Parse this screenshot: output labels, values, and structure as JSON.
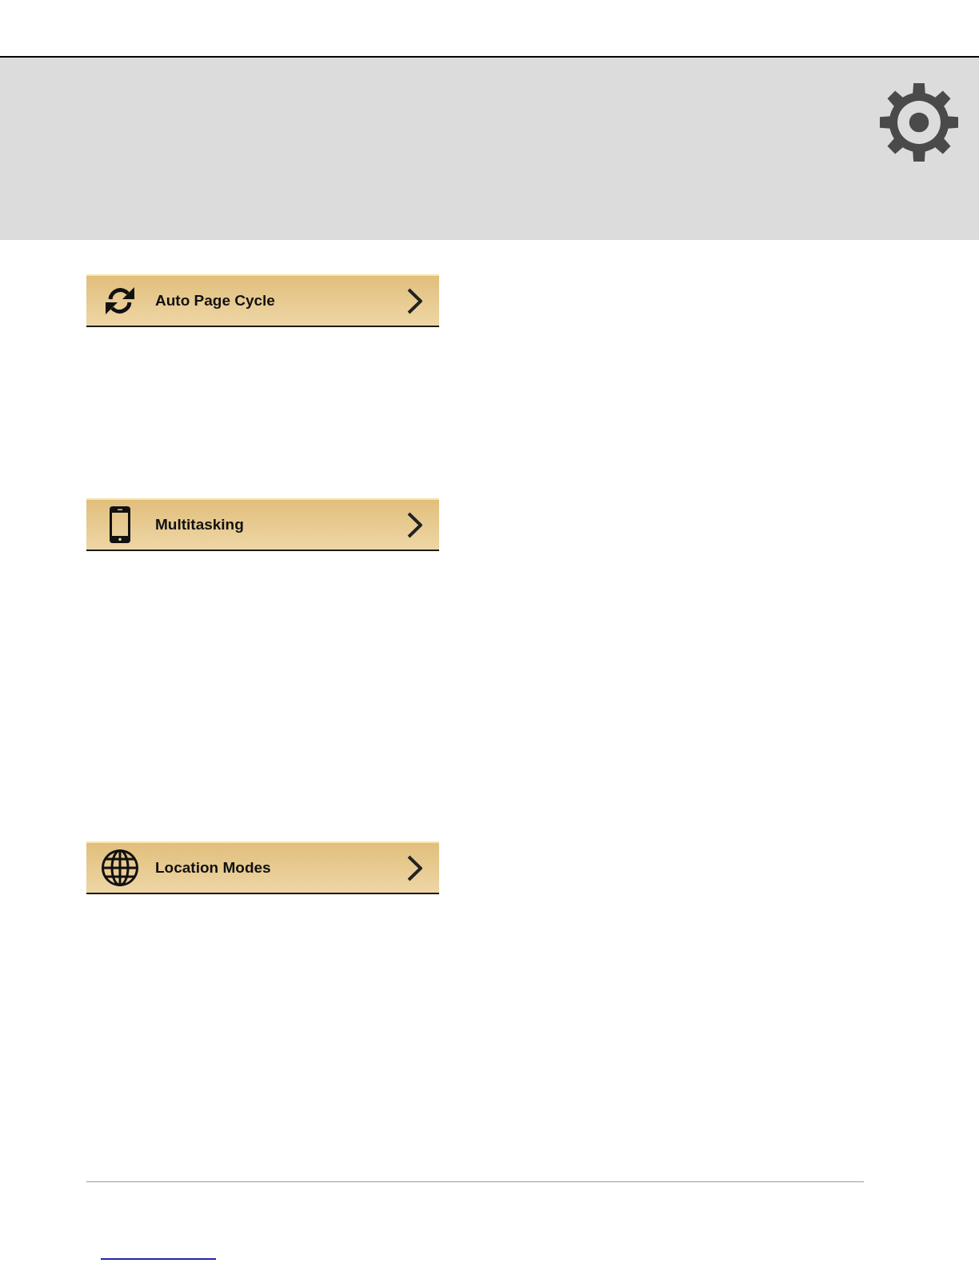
{
  "settings_items": [
    {
      "label": "Auto Page Cycle"
    },
    {
      "label": "Multitasking"
    },
    {
      "label": "Location Modes"
    }
  ]
}
